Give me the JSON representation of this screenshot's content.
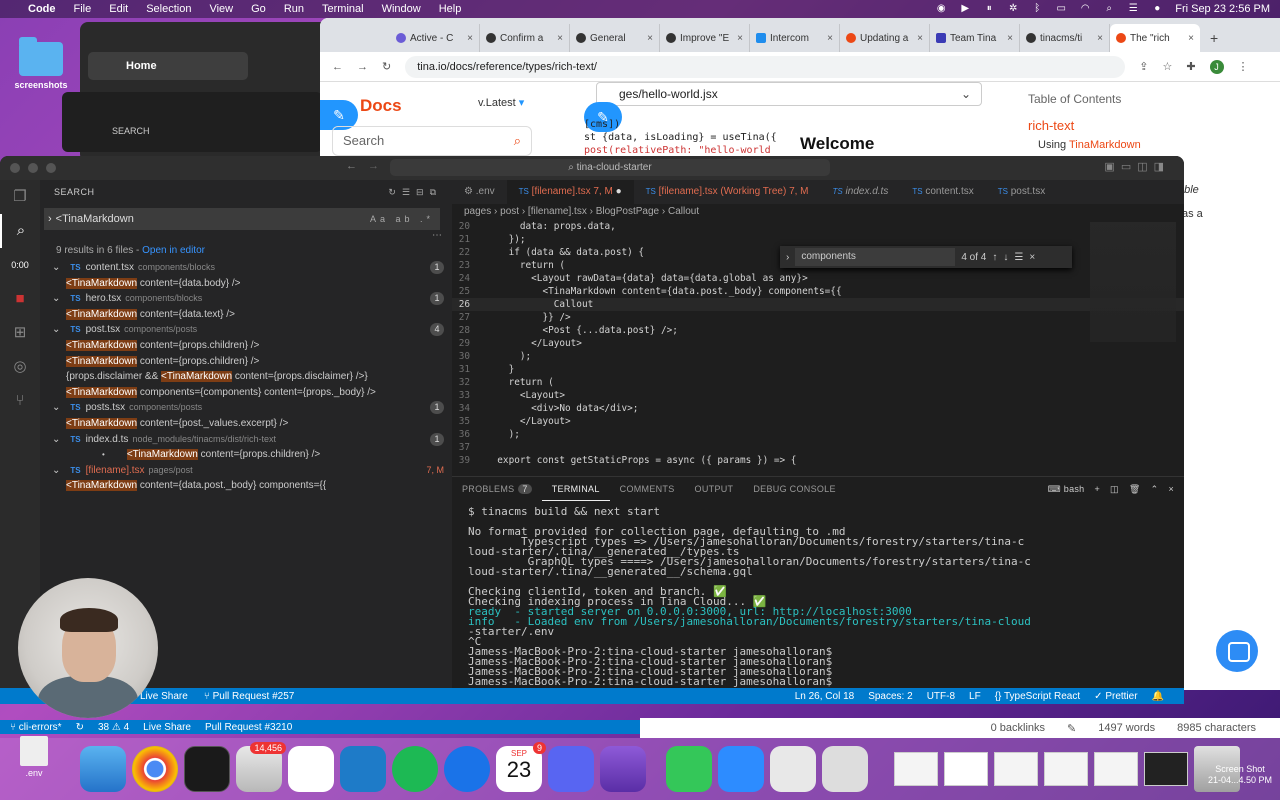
{
  "menubar": {
    "app": "Code",
    "items": [
      "File",
      "Edit",
      "Selection",
      "View",
      "Go",
      "Run",
      "Terminal",
      "Window",
      "Help"
    ],
    "clock": "Fri Sep 23  2:56 PM"
  },
  "desktop": {
    "folder_label": "screenshots",
    "finder_home": "Home",
    "finder_search": "SEARCH",
    "timer": "0:00"
  },
  "browser": {
    "tabs": [
      "Active - C",
      "Confirm a",
      "General",
      "Improve \"E",
      "Intercom",
      "Updating a",
      "Team Tina",
      "tinacms/ti",
      "The \"rich"
    ],
    "url": "tina.io/docs/reference/types/rich-text/",
    "docs_logo": "Docs",
    "version": "v.Latest",
    "search_placeholder": "Search",
    "file_path": "ges/hello-world.jsx",
    "code_preview": [
      "[cms])",
      "st {data, isLoading} = useTina({",
      "  post(relativePath: \"hello-world"
    ],
    "welcome": "Welcome",
    "toc_title": "Table of Contents",
    "toc_selected": "rich-text",
    "toc_sub_prefix": "Using",
    "toc_sub_link": "TinaMarkdown",
    "side_text_1": "able",
    "side_text_2": "as a"
  },
  "vscode": {
    "title": "tina-cloud-starter",
    "sidebar_title": "SEARCH",
    "search_value": "<TinaMarkdown",
    "summary": "9 results in 6 files - ",
    "open_editor": "Open in editor",
    "results": [
      {
        "file": "content.tsx",
        "path": "components/blocks",
        "count": "1",
        "lines": [
          {
            "hl": "<TinaMarkdown",
            "rest": " content={data.body} />"
          }
        ]
      },
      {
        "file": "hero.tsx",
        "path": "components/blocks",
        "count": "1",
        "lines": [
          {
            "hl": "<TinaMarkdown",
            "rest": " content={data.text} />"
          }
        ]
      },
      {
        "file": "post.tsx",
        "path": "components/posts",
        "count": "4",
        "lines": [
          {
            "hl": "<TinaMarkdown",
            "rest": " content={props.children} />"
          },
          {
            "hl": "<TinaMarkdown",
            "rest": " content={props.children} />"
          },
          {
            "pre": "{props.disclaimer && ",
            "hl": "<TinaMarkdown",
            "rest": " content={props.disclaimer} />}"
          },
          {
            "hl": "<TinaMarkdown",
            "rest": " components={components} content={props._body} />"
          }
        ]
      },
      {
        "file": "posts.tsx",
        "path": "components/posts",
        "count": "1",
        "lines": [
          {
            "hl": "<TinaMarkdown",
            "rest": " content={post._values.excerpt} />"
          }
        ]
      },
      {
        "file": "index.d.ts",
        "path": "node_modules/tinacms/dist/rich-text",
        "count": "1",
        "lines": [
          {
            "hl": "<TinaMarkdown",
            "rest": " content={props.children} />"
          }
        ]
      },
      {
        "file": "[filename].tsx",
        "path": "pages/post",
        "count": "7, M",
        "mod": true,
        "lines": [
          {
            "hl": "<TinaMarkdown",
            "rest": " content={data.post._body} components={{"
          }
        ]
      }
    ],
    "editor_tabs": [
      ".env",
      "[filename].tsx  7, M",
      "[filename].tsx (Working Tree)  7, M",
      "index.d.ts",
      "content.tsx",
      "post.tsx"
    ],
    "breadcrumb": "pages › post › [filename].tsx › BlogPostPage › Callout",
    "find": {
      "value": "components",
      "count": "4 of 4"
    },
    "code_lines": [
      {
        "n": "20",
        "t": "      data: props.data,"
      },
      {
        "n": "21",
        "t": "    });"
      },
      {
        "n": "22",
        "t": "    if (data && data.post) {"
      },
      {
        "n": "23",
        "t": "      return ("
      },
      {
        "n": "24",
        "t": "        <Layout rawData={data} data={data.global as any}>"
      },
      {
        "n": "25",
        "t": "          <TinaMarkdown content={data.post._body} components={{"
      },
      {
        "n": "26",
        "t": "            Callout"
      },
      {
        "n": "27",
        "t": "          }} />"
      },
      {
        "n": "28",
        "t": "          <Post {...data.post} />;"
      },
      {
        "n": "29",
        "t": "        </Layout>"
      },
      {
        "n": "30",
        "t": "      );"
      },
      {
        "n": "31",
        "t": "    }"
      },
      {
        "n": "32",
        "t": "    return ("
      },
      {
        "n": "33",
        "t": "      <Layout>"
      },
      {
        "n": "34",
        "t": "        <div>No data</div>;"
      },
      {
        "n": "35",
        "t": "      </Layout>"
      },
      {
        "n": "36",
        "t": "    );"
      },
      {
        "n": "37",
        "t": ""
      },
      {
        "n": "39",
        "t": "  export const getStaticProps = async ({ params }) => {"
      }
    ],
    "panel_tabs": [
      "PROBLEMS",
      "TERMINAL",
      "COMMENTS",
      "OUTPUT",
      "DEBUG CONSOLE"
    ],
    "problems_count": "7",
    "terminal_label": "bash",
    "terminal": [
      "$ tinacms build && next start",
      "",
      "No format provided for collection page, defaulting to .md",
      "        Typescript types => /Users/jamesohalloran/Documents/forestry/starters/tina-c",
      "loud-starter/.tina/__generated__/types.ts",
      "         GraphQL types ====> /Users/jamesohalloran/Documents/forestry/starters/tina-c",
      "loud-starter/.tina/__generated__/schema.gql",
      "",
      "Checking clientId, token and branch. ✅",
      "Checking indexing process in Tina Cloud... ✅",
      "ready  - started server on 0.0.0.0:3000, url: http://localhost:3000",
      "info   - Loaded env from /Users/jamesohalloran/Documents/forestry/starters/tina-cloud",
      "-starter/.env",
      "^C",
      "Jamess-MacBook-Pro-2:tina-cloud-starter jamesohalloran$",
      "Jamess-MacBook-Pro-2:tina-cloud-starter jamesohalloran$",
      "Jamess-MacBook-Pro-2:tina-cloud-starter jamesohalloran$",
      "Jamess-MacBook-Pro-2:tina-cloud-starter jamesohalloran$"
    ],
    "status": {
      "live_share": "Live Share",
      "pr": "Pull Request #257",
      "pos": "Ln 26, Col 18",
      "spaces": "Spaces: 2",
      "enc": "UTF-8",
      "eol": "LF",
      "lang": "TypeScript React",
      "prettier": "Prettier"
    }
  },
  "status2": {
    "branch": "cli-errors*",
    "problems": "38 ⚠ 4",
    "live_share": "Live Share",
    "pr": "Pull Request #3210"
  },
  "obsidian": {
    "backlinks": "0 backlinks",
    "words": "1497 words",
    "chars": "8985 characters"
  },
  "dock": {
    "env_label": ".env",
    "mail_badge": "14,456",
    "calendar_month": "SEP",
    "calendar_day": "23",
    "calendar_badge": "9",
    "screenshot_label": "Screen Shot",
    "screenshot_date": "21-04...4.50 PM"
  }
}
